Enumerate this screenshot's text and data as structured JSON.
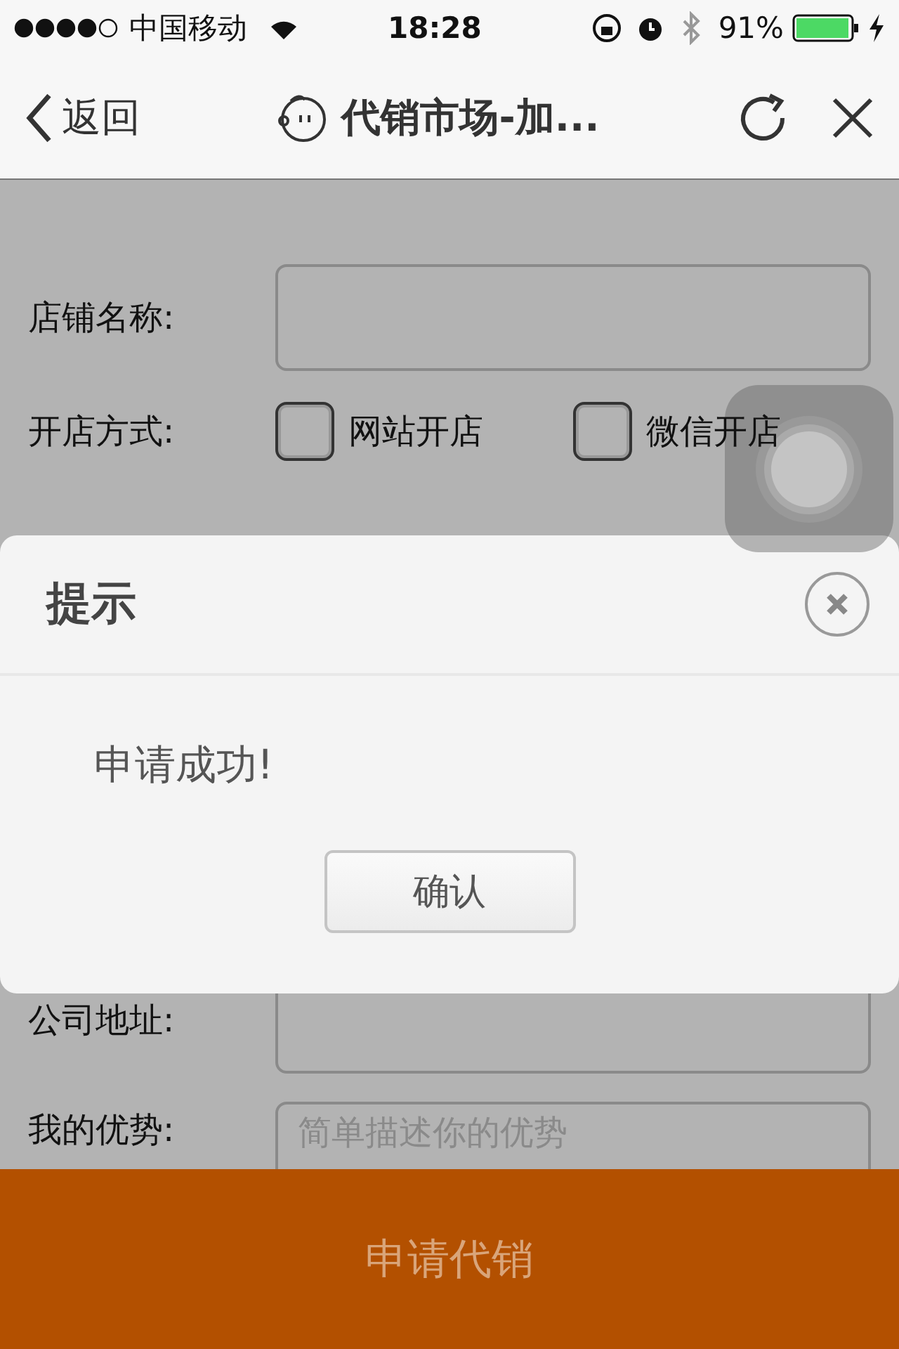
{
  "status_bar": {
    "carrier": "中国移动",
    "time": "18:28",
    "battery": "91%"
  },
  "nav": {
    "back": "返回",
    "title": "代销市场-加..."
  },
  "form": {
    "shop_name": {
      "label": "店铺名称:"
    },
    "shop_mode": {
      "label": "开店方式:",
      "options": [
        {
          "label": "网站开店",
          "checked": false
        },
        {
          "label": "微信开店",
          "checked": false
        }
      ]
    },
    "address": {
      "label": "公司地址:"
    },
    "advantage": {
      "label": "我的优势:",
      "placeholder": "简单描述你的优势"
    }
  },
  "dialog": {
    "title": "提示",
    "message": "申请成功!",
    "confirm": "确认"
  },
  "submit": "申请代销"
}
